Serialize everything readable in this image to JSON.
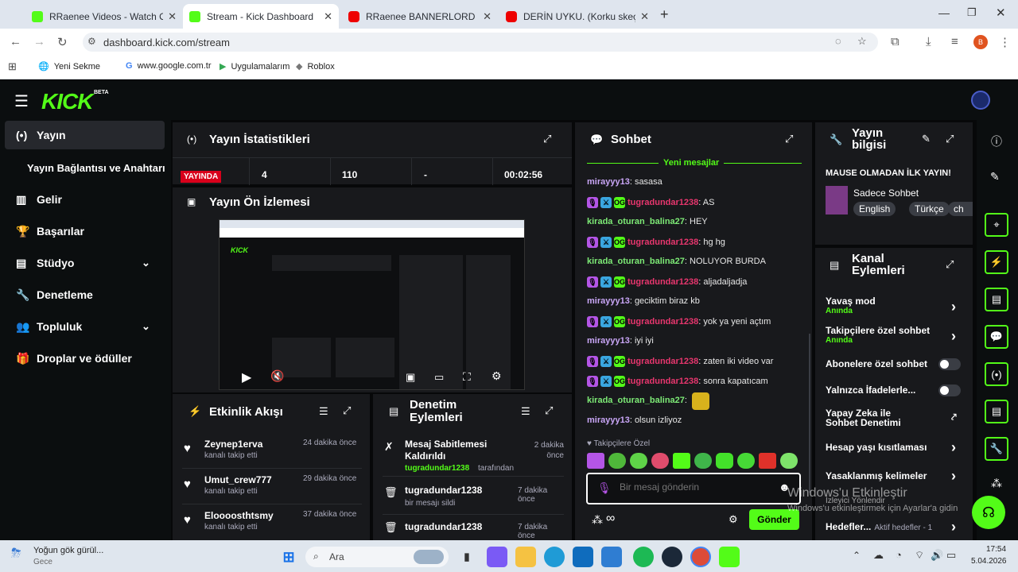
{
  "browser": {
    "tabs": [
      {
        "label": "RRaenee Videos - Watch On-De",
        "icon_color": "#53fc18"
      },
      {
        "label": "Stream - Kick Dashboard",
        "icon_color": "#53fc18"
      },
      {
        "label": "RRaenee BANNERLORD KOMİK",
        "icon_color": "#e00"
      },
      {
        "label": "DERİN UYKU. (Korku skeç) - Yo",
        "icon_color": "#e00"
      }
    ],
    "url": "dashboard.kick.com/stream",
    "bookmarks": [
      "Yeni Sekme",
      "www.google.com.tr",
      "Uygulamalarım",
      "Roblox"
    ],
    "profile_initial": "B"
  },
  "brand": {
    "logo": "KICK",
    "beta": "BETA",
    "accent": "#53fc18"
  },
  "sidebar": {
    "items": [
      {
        "label": "Yayın",
        "icon": "broadcast-icon"
      },
      {
        "label": "Yayın Bağlantısı ve Anahtarı",
        "icon": ""
      },
      {
        "label": "Gelir",
        "icon": "chart-icon"
      },
      {
        "label": "Başarılar",
        "icon": "trophy-icon"
      },
      {
        "label": "Stüdyo",
        "icon": "studio-icon"
      },
      {
        "label": "Denetleme",
        "icon": "wrench-icon"
      },
      {
        "label": "Topluluk",
        "icon": "people-icon"
      },
      {
        "label": "Droplar ve ödüller",
        "icon": "gift-icon"
      }
    ]
  },
  "stats": {
    "title": "Yayın İstatistikleri",
    "live_badge": "YAYINDA",
    "values": [
      "4",
      "110",
      "-",
      "00:02:56"
    ]
  },
  "preview": {
    "title": "Yayın Ön İzlemesi"
  },
  "activity": {
    "title": "Etkinlik Akışı",
    "items": [
      {
        "user": "Zeynep1erva",
        "action": "kanalı takip etti",
        "time": "24 dakika önce"
      },
      {
        "user": "Umut_crew777",
        "action": "kanalı takip etti",
        "time": "29 dakika önce"
      },
      {
        "user": "Eloooosthtsmy",
        "action": "kanalı takip etti",
        "time": "37 dakika önce"
      }
    ]
  },
  "moderation": {
    "title": "Denetim Eylemleri",
    "items": [
      {
        "title": "Mesaj Sabitlemesi Kaldırıldı",
        "by_user": "tugradundar1238",
        "by_suffix": "tarafından",
        "time": "2 dakika önce"
      },
      {
        "title": "tugradundar1238",
        "sub": "bir mesajı sildi",
        "time": "7 dakika önce"
      },
      {
        "title": "tugradundar1238",
        "sub": "",
        "time": "7 dakika önce"
      }
    ]
  },
  "chat": {
    "title": "Sohbet",
    "new_messages": "Yeni mesajlar",
    "messages": [
      {
        "user": "mirayyy13",
        "text": ": sasasa",
        "style": "purp",
        "badges": false
      },
      {
        "user": "tugradundar1238",
        "text": ": AS",
        "style": "pink",
        "badges": true
      },
      {
        "user": "kirada_oturan_balina27",
        "text": ": HEY",
        "style": "grn",
        "badges": false
      },
      {
        "user": "tugradundar1238",
        "text": ": hg hg",
        "style": "pink",
        "badges": true
      },
      {
        "user": "kirada_oturan_balina27",
        "text": ": NOLUYOR BURDA",
        "style": "grn",
        "badges": false
      },
      {
        "user": "tugradundar1238",
        "text": ": aljadaljadja",
        "style": "pink",
        "badges": true
      },
      {
        "user": "mirayyy13",
        "text": ": geciktim biraz kb",
        "style": "purp",
        "badges": false
      },
      {
        "user": "tugradundar1238",
        "text": ": yok ya yeni açtım",
        "style": "pink",
        "badges": true
      },
      {
        "user": "mirayyy13",
        "text": ": iyi iyi",
        "style": "purp",
        "badges": false
      },
      {
        "user": "tugradundar1238",
        "text": ": zaten iki video var",
        "style": "pink",
        "badges": true
      },
      {
        "user": "tugradundar1238",
        "text": ": sonra kapatıcam",
        "style": "pink",
        "badges": true
      },
      {
        "user": "kirada_oturan_balina27",
        "text": ":",
        "style": "grn",
        "badges": false
      },
      {
        "user": "mirayyy13",
        "text": ": olsun izliyoz",
        "style": "purp",
        "badges": false
      }
    ],
    "followers_only": "Takipçilere Özel",
    "placeholder": "Bir mesaj gönderin",
    "send": "Gönder"
  },
  "stream_info": {
    "title": "Yayın bilgisi",
    "stream_title": "MAUSE OLMADAN İLK YAYIN!",
    "category": "Sadece Sohbet",
    "tags": [
      "English",
      "Türkçe",
      "ch"
    ]
  },
  "channel_actions": {
    "title": "Kanal Eylemleri",
    "rows": [
      {
        "label": "Yavaş mod",
        "sub": "Anında",
        "control": "chevron"
      },
      {
        "label": "Takipçilere özel sohbet",
        "sub": "Anında",
        "control": "chevron"
      },
      {
        "label": "Abonelere özel sohbet",
        "sub": "",
        "control": "toggle"
      },
      {
        "label": "Yalnızca İfadelerle...",
        "sub": "",
        "control": "toggle"
      },
      {
        "label": "Yapay Zeka ile Sohbet Denetimi",
        "sub": "",
        "control": "external"
      },
      {
        "label": "Hesap yaşı kısıtlaması",
        "sub": "",
        "control": "chevron"
      },
      {
        "label": "Yasaklanmış kelimeler",
        "sub": "",
        "control": "chevron"
      },
      {
        "label": "Hedefler...",
        "sub": "Aktif hedefler - 1",
        "control": "chevron"
      }
    ]
  },
  "watermark": {
    "line1": "Windows'u Etkinleştir",
    "line2": "Windows'u etkinleştirmek için Ayarlar'a gidin",
    "overlay": "İzleyici Yönlendir"
  },
  "taskbar": {
    "weather": "Yoğun gök gürül...",
    "weather_sub": "Gece",
    "search": "Ara",
    "time": "17:54",
    "date": "5.04.2026"
  }
}
